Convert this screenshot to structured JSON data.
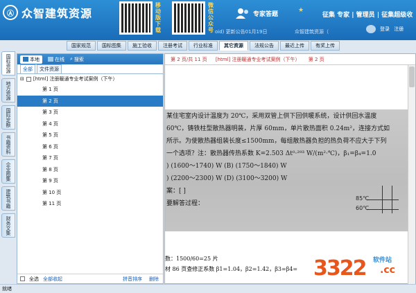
{
  "app": {
    "logo_letter": "Ⓐ",
    "title": "众智建筑资源"
  },
  "qr": [
    {
      "caption": "移动版下载"
    },
    {
      "caption": "微信公众号"
    }
  ],
  "header": {
    "expert_answer": "专家答题",
    "expert_mark": "★",
    "expert_label": "征集 专家",
    "menu": "征集 专家 | 管理员 | 征集超级收",
    "notice": "oid) 更新公告01月19日",
    "notice2": "众智建筑资源（",
    "login": "登录",
    "register": "注册"
  },
  "navtabs": [
    "国家规范",
    "国标图集",
    "施工验收",
    "注册考试",
    "行业标准",
    "其它资源",
    "法规公告",
    "最近上传",
    "有奖上传"
  ],
  "active_navtab": 5,
  "side_tabs": [
    "国标资源",
    "地方资源",
    "国际定额",
    "书籍资料",
    "企业图集",
    "建筑书籍",
    "财务文集"
  ],
  "panel": {
    "subtabs": [
      "本地",
      "在线",
      "搜索"
    ],
    "filters": [
      "全部",
      "文件资源"
    ],
    "root_label": "[html] 注册暖通专业考试案例（下午）",
    "pages": [
      "第 1 页",
      "第 2 页",
      "第 3 页",
      "第 4 页",
      "第 5 页",
      "第 6 页",
      "第 7 页",
      "第 8 页",
      "第 9 页",
      "第 10 页",
      "第 11 页"
    ],
    "selected_page": 1,
    "bottom": {
      "select_all": "全选",
      "all_fav": "全部收起",
      "pinyin_sort": "拼音排序",
      "delete": "删除"
    }
  },
  "doc": {
    "header_parts": [
      "第 2 页/共 11 页",
      "[html] 注册暖通专业考试案例（下午）",
      "第 2 页"
    ],
    "lines": [
      "某住宅室内设计温度为 20℃，采用双管上供下回供暖系统，设计供回水温度",
      "60℃，铸铁柱型散热器明装，片厚 60mm，单片散热面积 0.24m²，连接方式如",
      "所示。为使散热器组装长度≤1500mm，每组散热器负担的热负荷不应大于下列",
      "一个选项？注：散热器传热系数 K=2.503 Δt⁰·²⁹³ W/(m²·℃)，β₁=β₄=1.0",
      ") (1600～1740) W          (B) (1750～1840) W",
      ") (2200～2300) W          (D) (3100～3200) W",
      "案：[          ]",
      "要解答过程："
    ],
    "diagram_labels": [
      "85℃",
      "60℃"
    ],
    "under_lines": [
      "数：1500/60=25 片",
      "材 86 页查修正系数 β1=1.04，β2=1.42，β3=β4="
    ]
  },
  "status": "就绪",
  "watermark": {
    "number": "3322",
    "cc": ".cc",
    "site": "软件站"
  }
}
